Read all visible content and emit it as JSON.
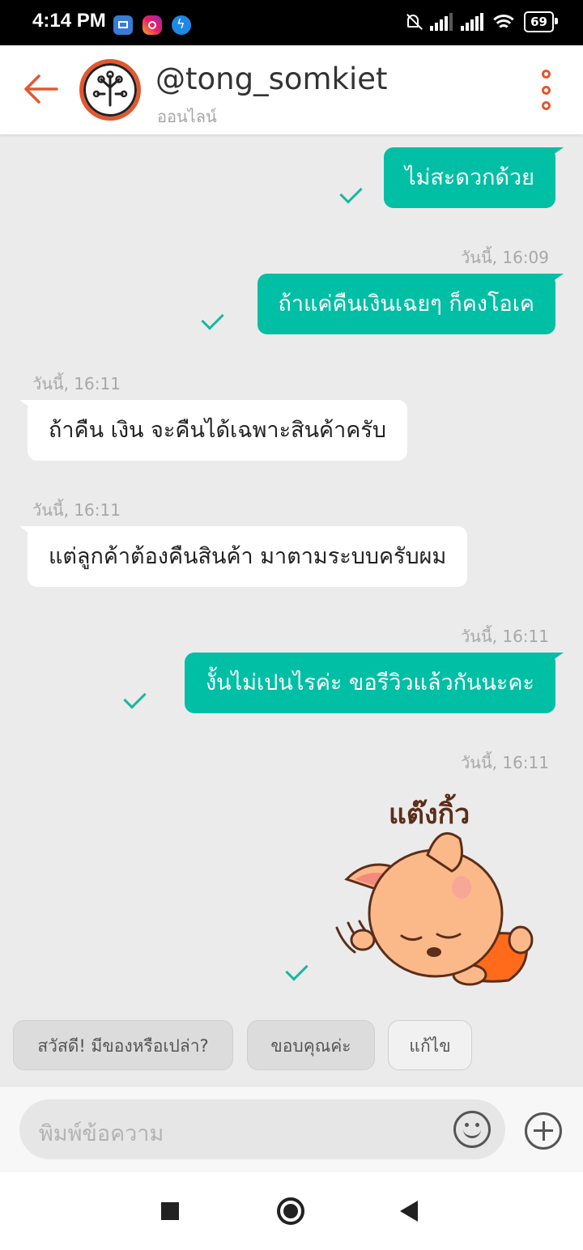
{
  "status_bar": {
    "time": "4:14 PM",
    "battery": "69"
  },
  "header": {
    "contact_name": "@tong_somkiet",
    "contact_status": "ออนไลน์"
  },
  "messages": [
    {
      "direction": "out",
      "text": "ไม่สะดวกด้วย",
      "timestamp": ""
    },
    {
      "direction": "out",
      "text": "ถ้าแค่คืนเงินเฉยๆ ก็คงโอเค",
      "timestamp": "วันนี้, 16:09"
    },
    {
      "direction": "in",
      "text": "ถ้าคืน เงิน จะคืนได้เฉพาะสินค้าครับ",
      "timestamp": "วันนี้, 16:11"
    },
    {
      "direction": "in",
      "text": "แต่ลูกค้าต้องคืนสินค้า มาตามระบบครับผม",
      "timestamp": "วันนี้, 16:11"
    },
    {
      "direction": "out",
      "text": "งั้นไม่เปนไรค่ะ ขอรีวิวแล้วกันนะคะ",
      "timestamp": "วันนี้, 16:11"
    },
    {
      "direction": "out",
      "sticker_text": "แต๊งกิ้ว",
      "timestamp": "วันนี้, 16:11"
    }
  ],
  "quick_replies": [
    "สวัสดี! มีของหรือเปล่า?",
    "ขอบคุณค่ะ",
    "แก้ไข"
  ],
  "composer": {
    "placeholder": "พิมพ์ข้อความ"
  },
  "colors": {
    "accent": "#e4572e",
    "outgoing_bubble": "#00bfa5",
    "check": "#18b89c"
  }
}
